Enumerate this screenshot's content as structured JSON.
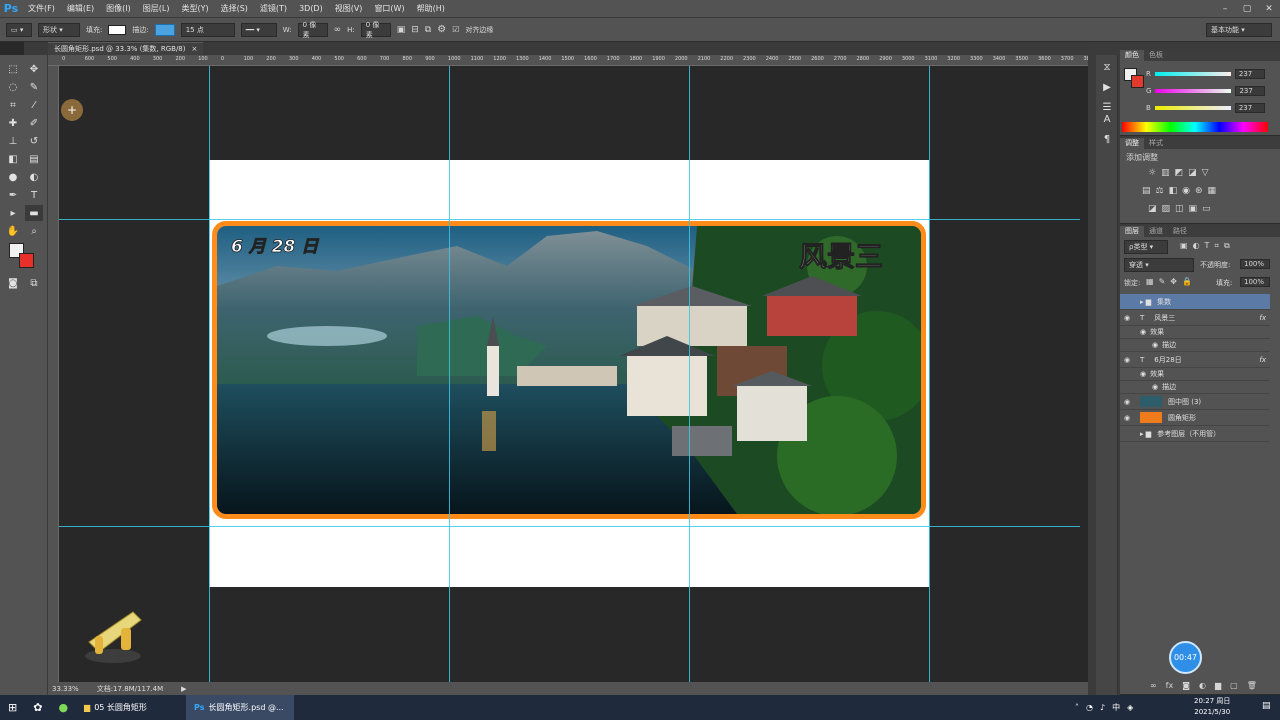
{
  "app": {
    "logo": "Ps",
    "workspace": "基本功能"
  },
  "menu": [
    "文件(F)",
    "编辑(E)",
    "图像(I)",
    "图层(L)",
    "类型(Y)",
    "选择(S)",
    "滤镜(T)",
    "3D(D)",
    "视图(V)",
    "窗口(W)",
    "帮助(H)"
  ],
  "options": {
    "mode": "形状",
    "fill_label": "填充:",
    "stroke_label": "描边:",
    "stroke_size": "15 点",
    "w_label": "W:",
    "w_value": "0 像素",
    "h_label": "H:",
    "h_value": "0 像素",
    "align_edges": "对齐边缘"
  },
  "document": {
    "tab": "长圆角矩形.psd @ 33.3% (集数, RGB/8)",
    "date_text": "6 月 28 日",
    "title_text": "风景三"
  },
  "ruler_ticks": [
    "0",
    "600",
    "500",
    "400",
    "300",
    "200",
    "100",
    "0",
    "100",
    "200",
    "300",
    "400",
    "500",
    "600",
    "700",
    "800",
    "900",
    "1000",
    "1100",
    "1200",
    "1300",
    "1400",
    "1500",
    "1600",
    "1700",
    "1800",
    "1900",
    "2000",
    "2100",
    "2200",
    "2300",
    "2400",
    "2500",
    "2600",
    "2700",
    "2800",
    "2900",
    "3000",
    "3100",
    "3200",
    "3300",
    "3400",
    "3500",
    "3600",
    "3700",
    "3800"
  ],
  "color_panel": {
    "tabs": [
      "颜色",
      "色板"
    ],
    "channels": [
      {
        "label": "R",
        "value": "237"
      },
      {
        "label": "G",
        "value": "237"
      },
      {
        "label": "B",
        "value": "237"
      }
    ]
  },
  "adjust_panel": {
    "tabs": [
      "调整",
      "样式"
    ],
    "title": "添加调整"
  },
  "layers_panel": {
    "tabs": [
      "图层",
      "通道",
      "路径"
    ],
    "filter": "ρ类型",
    "blend": "穿透",
    "opacity_label": "不透明度:",
    "opacity": "100%",
    "lock_label": "锁定:",
    "fill_label": "填充:",
    "fill": "100%",
    "layers": [
      {
        "name": "集数",
        "kind": "group"
      },
      {
        "name": "风景三",
        "kind": "text"
      },
      {
        "name": "效果",
        "kind": "effect"
      },
      {
        "name": "描边",
        "kind": "sub"
      },
      {
        "name": "6月28日",
        "kind": "text"
      },
      {
        "name": "效果",
        "kind": "effect"
      },
      {
        "name": "描边",
        "kind": "sub"
      },
      {
        "name": "图中图 (3)",
        "kind": "image"
      },
      {
        "name": "圆角矩形",
        "kind": "shape"
      },
      {
        "name": "参考图层（不用管）",
        "kind": "group"
      }
    ]
  },
  "status": {
    "zoom": "33.33%",
    "doc_size": "文档:17.8M/117.4M"
  },
  "taskbar": {
    "item1": "05 长圆角矩形",
    "item2": "长圆角矩形.psd @...",
    "time": "20:27 周日",
    "date": "2021/5/30",
    "ime": "中"
  },
  "timer": "00:47"
}
